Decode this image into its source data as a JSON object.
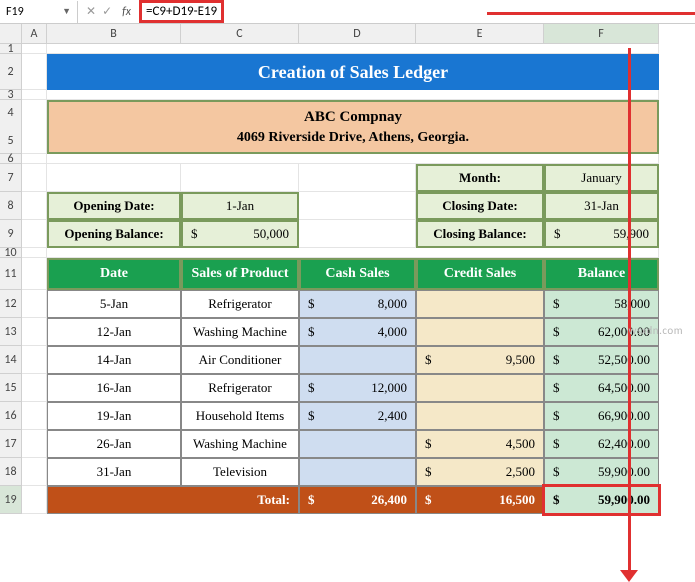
{
  "nameBox": "F19",
  "formula": "=C9+D19-E19",
  "cols": [
    "",
    "A",
    "B",
    "C",
    "D",
    "E",
    "F"
  ],
  "title": "Creation of Sales Ledger",
  "company": {
    "name": "ABC Compnay",
    "address": "4069 Riverside Drive, Athens, Georgia."
  },
  "info": {
    "openingDateLabel": "Opening Date:",
    "openingDate": "1-Jan",
    "openingBalLabel": "Opening Balance:",
    "openingBalCur": "$",
    "openingBalVal": "50,000",
    "monthLabel": "Month:",
    "month": "January",
    "closingDateLabel": "Closing Date:",
    "closingDate": "31-Jan",
    "closingBalLabel": "Closing Balance:",
    "closingBalCur": "$",
    "closingBalVal": "59,900"
  },
  "headers": [
    "Date",
    "Sales of Product",
    "Cash Sales",
    "Credit Sales",
    "Balance"
  ],
  "rows": [
    {
      "date": "5-Jan",
      "product": "Refrigerator",
      "cash": "8,000",
      "credit": "",
      "bal": "58,000"
    },
    {
      "date": "12-Jan",
      "product": "Washing Machine",
      "cash": "4,000",
      "credit": "",
      "bal": "62,000.00"
    },
    {
      "date": "14-Jan",
      "product": "Air Conditioner",
      "cash": "",
      "credit": "9,500",
      "bal": "52,500.00"
    },
    {
      "date": "16-Jan",
      "product": "Refrigerator",
      "cash": "12,000",
      "credit": "",
      "bal": "64,500.00"
    },
    {
      "date": "19-Jan",
      "product": "Household Items",
      "cash": "2,400",
      "credit": "",
      "bal": "66,900.00"
    },
    {
      "date": "26-Jan",
      "product": "Washing Machine",
      "cash": "",
      "credit": "4,500",
      "bal": "62,400.00"
    },
    {
      "date": "31-Jan",
      "product": "Television",
      "cash": "",
      "credit": "2,500",
      "bal": "59,900.00"
    }
  ],
  "totals": {
    "label": "Total:",
    "cash": "26,400",
    "credit": "16,500",
    "bal": "59,900.00"
  },
  "cur": "$",
  "watermark": "wsxdn.com",
  "rowNums": [
    "1",
    "2",
    "3",
    "4",
    "5",
    "6",
    "7",
    "8",
    "9",
    "10",
    "11",
    "12",
    "13",
    "14",
    "15",
    "16",
    "17",
    "18",
    "19"
  ]
}
